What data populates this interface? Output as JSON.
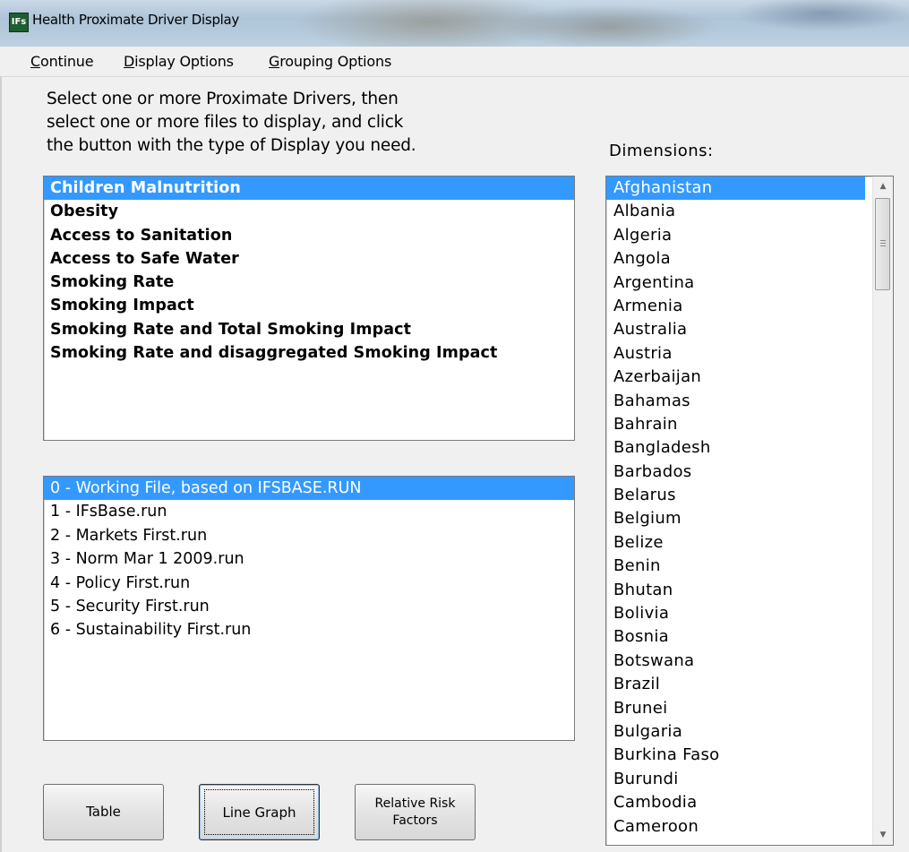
{
  "window": {
    "title": "Health Proximate Driver Display",
    "icon": "IFs-app-icon"
  },
  "menu": {
    "continue": "Continue",
    "display_options": "Display Options",
    "grouping_options": "Grouping Options"
  },
  "instructions": "Select one or more Proximate Drivers, then\nselect one or more files to display, and click\nthe button with the type of Display you need.",
  "dimensions_label": "Dimensions:",
  "drivers": [
    "Children Malnutrition",
    "Obesity",
    "Access to Sanitation",
    "Access to Safe Water",
    "Smoking Rate",
    "Smoking Impact",
    "Smoking Rate and Total Smoking Impact",
    "Smoking Rate and disaggregated Smoking Impact"
  ],
  "drivers_selected_index": 0,
  "files": [
    "0 - Working File, based on IFSBASE.RUN",
    "1 - IFsBase.run",
    "2 - Markets First.run",
    "3 - Norm Mar 1 2009.run",
    "4 - Policy First.run",
    "5 - Security First.run",
    "6 - Sustainability First.run"
  ],
  "files_selected_index": 0,
  "dimensions": [
    "Afghanistan",
    "Albania",
    "Algeria",
    "Angola",
    "Argentina",
    "Armenia",
    "Australia",
    "Austria",
    "Azerbaijan",
    "Bahamas",
    "Bahrain",
    "Bangladesh",
    "Barbados",
    "Belarus",
    "Belgium",
    "Belize",
    "Benin",
    "Bhutan",
    "Bolivia",
    "Bosnia",
    "Botswana",
    "Brazil",
    "Brunei",
    "Bulgaria",
    "Burkina Faso",
    "Burundi",
    "Cambodia",
    "Cameroon"
  ],
  "dimensions_selected_index": 0,
  "buttons": {
    "table": "Table",
    "line_graph": "Line Graph",
    "relative_risk_line1": "Relative Risk",
    "relative_risk_line2": "Factors"
  },
  "colors": {
    "selection": "#3399ff",
    "window_bg": "#f0f0f0"
  }
}
